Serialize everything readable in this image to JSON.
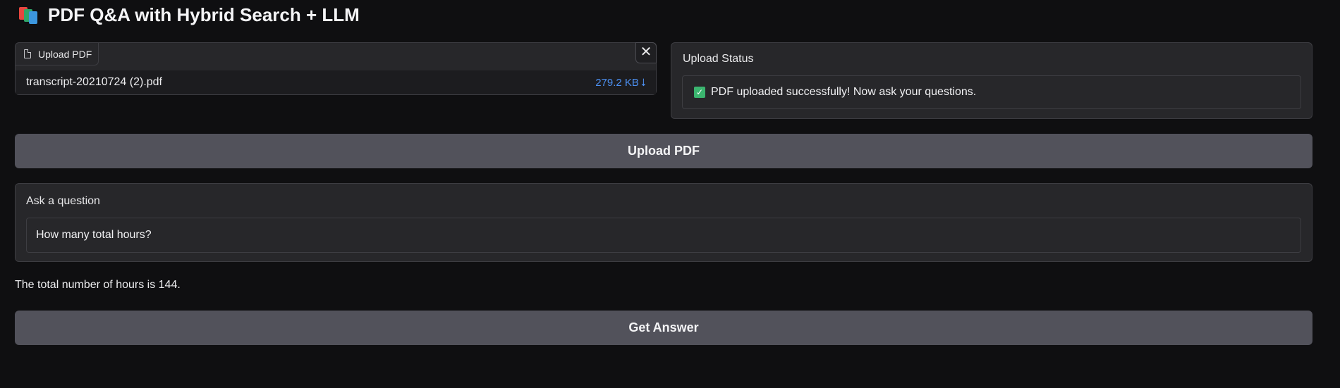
{
  "header": {
    "icon": "books-icon",
    "title": "PDF Q&A with Hybrid Search + LLM"
  },
  "file_upload": {
    "tab_label": "Upload PDF",
    "file_name": "transcript-20210724 (2).pdf",
    "file_size": "279.2 KB",
    "download_glyph": "⭣",
    "close_glyph": "✕"
  },
  "upload_status": {
    "label": "Upload Status",
    "check_glyph": "✓",
    "message": "PDF uploaded successfully! Now ask your questions."
  },
  "upload_button": {
    "label": "Upload PDF"
  },
  "question": {
    "label": "Ask a question",
    "value": "How many total hours?"
  },
  "answer": {
    "text": "The total number of hours is 144."
  },
  "get_answer_button": {
    "label": "Get Answer"
  },
  "colors": {
    "background": "#0f0f11",
    "panel": "#27272a",
    "button": "#52525b",
    "link": "#4c8ff0",
    "success": "#3bb56f"
  }
}
